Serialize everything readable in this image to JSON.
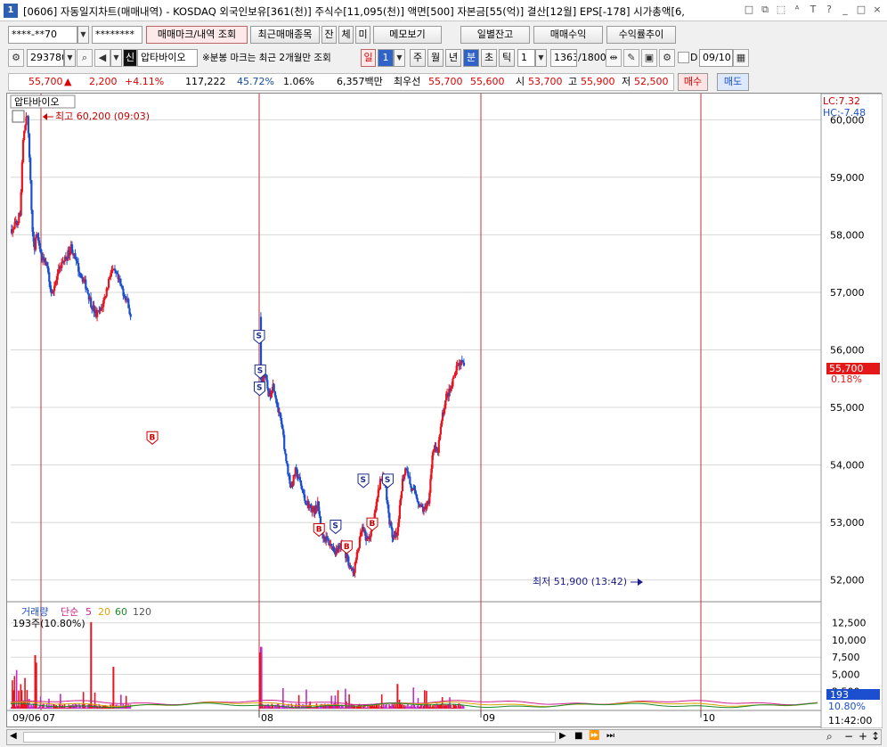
{
  "window": {
    "num": "1",
    "title": "[0606] 자동일지차트(매매내역) - KOSDAQ 외국인보유[361(천)] 주식수[11,095(천)] 액면[500] 자본금[55(억)] 결산[12월] EPS[-178] 시가총액[6,",
    "ctrl_icons": [
      "□",
      "⧉",
      "⬚",
      "ᴬ",
      "T",
      "?",
      "_",
      "□",
      "×"
    ]
  },
  "toolbar1": {
    "account": "****-**70",
    "password": "********",
    "mark_btn": "매매마크/내역 조회",
    "recent_btn": "최근매매종목",
    "jan_btn": "잔",
    "che_btn": "체",
    "mi_btn": "미",
    "memo_btn": "메모보기",
    "daily_btn": "일별잔고",
    "profit_btn": "매매수익",
    "return_btn": "수익률추이"
  },
  "toolbar2": {
    "code": "293780",
    "shin": "신",
    "name": "압타바이오",
    "note": "※분봉 마크는 최근 2개월만 조회",
    "period_label": "일",
    "period_value": "1",
    "weekly": "주",
    "monthly": "월",
    "yearly": "년",
    "minute": "분",
    "second": "초",
    "tick": "틱",
    "interval": "1",
    "count": "1363",
    "total": "/1800",
    "date": "09/10",
    "check_label": "D"
  },
  "infobar": {
    "price": "55,700",
    "arrow": "▲",
    "change": "2,200",
    "rate": "+4.11%",
    "volume": "117,222",
    "vol_ratio": "45.72%",
    "turnover": "1.06%",
    "amount": "6,357백만",
    "best_label": "최우선",
    "ask": "55,700",
    "bid": "55,600",
    "open_label": "시",
    "open": "53,700",
    "high_label": "고",
    "high": "55,900",
    "low_label": "저",
    "low": "52,500",
    "buy_btn": "매수",
    "sell_btn": "매도"
  },
  "chart": {
    "stock_tag": "압타바이오",
    "lc": "LC:7.32",
    "hc": "HC:-7.48",
    "high_note": "최고 60,200 (09:03)",
    "low_note": "최저 51,900 (13:42)",
    "price_tag": "55,700",
    "pct_tag": "0.18%",
    "vol_legend": {
      "label": "거래량",
      "ma_type": "단순",
      "ma5": "5",
      "ma20": "20",
      "ma60": "60",
      "ma120": "120"
    },
    "vol_info": "193주(10.80%)",
    "vol_tag": "193",
    "vol_pct_tag": "10.80%",
    "time_label": "11:42:00",
    "colors": {
      "up": "#e8141e",
      "down": "#1b4fd0",
      "vline": "#c33333",
      "grid": "#d8d8d8"
    }
  },
  "chart_data": {
    "type": "candlestick",
    "price_ticks": [
      52000,
      53000,
      54000,
      55000,
      56000,
      57000,
      58000,
      59000,
      60000
    ],
    "price_tick_labels": [
      "52,000",
      "53,000",
      "54,000",
      "55,000",
      "56,000",
      "57,000",
      "58,000",
      "59,000",
      "60,000"
    ],
    "price_range": [
      51700,
      60300
    ],
    "volume_ticks": [
      2500,
      5000,
      7500,
      10000,
      12500
    ],
    "volume_tick_labels": [
      "2,500",
      "5,000",
      "7,500",
      "10,000",
      "12,500"
    ],
    "volume_range": [
      0,
      13500
    ],
    "x_labels": [
      "09/06",
      "07",
      "08",
      "09",
      "10"
    ],
    "days": [
      "09/06",
      "09/07",
      "09/08",
      "09/09",
      "09/10"
    ],
    "close_path": [
      {
        "t": 0.0,
        "p": 58100
      },
      {
        "t": 0.02,
        "p": 58200
      },
      {
        "t": 0.035,
        "p": 58400
      },
      {
        "t": 0.045,
        "p": 59600
      },
      {
        "t": 0.055,
        "p": 59900
      },
      {
        "t": 0.063,
        "p": 60100
      },
      {
        "t": 0.07,
        "p": 59500
      },
      {
        "t": 0.08,
        "p": 58400
      },
      {
        "t": 0.09,
        "p": 57700
      },
      {
        "t": 0.1,
        "p": 58000
      },
      {
        "t": 0.12,
        "p": 57600
      },
      {
        "t": 0.14,
        "p": 57500
      },
      {
        "t": 0.16,
        "p": 57000
      },
      {
        "t": 0.18,
        "p": 57200
      },
      {
        "t": 0.2,
        "p": 57500
      },
      {
        "t": 0.22,
        "p": 57600
      },
      {
        "t": 0.24,
        "p": 57800
      },
      {
        "t": 0.26,
        "p": 57500
      },
      {
        "t": 0.28,
        "p": 57300
      },
      {
        "t": 0.3,
        "p": 57100
      },
      {
        "t": 0.32,
        "p": 56800
      },
      {
        "t": 0.34,
        "p": 56600
      },
      {
        "t": 0.36,
        "p": 56700
      },
      {
        "t": 0.38,
        "p": 57000
      },
      {
        "t": 0.4,
        "p": 57400
      },
      {
        "t": 0.42,
        "p": 57300
      },
      {
        "t": 0.44,
        "p": 57100
      },
      {
        "t": 0.46,
        "p": 56900
      },
      {
        "t": 0.47,
        "p": 56800
      },
      {
        "t": 0.5,
        "p": 55900
      },
      {
        "t": 0.52,
        "p": 55300
      },
      {
        "t": 0.54,
        "p": 55500
      },
      {
        "t": 0.56,
        "p": 55000
      },
      {
        "t": 0.58,
        "p": 54600
      },
      {
        "t": 0.6,
        "p": 54800
      },
      {
        "t": 0.62,
        "p": 54300
      },
      {
        "t": 0.64,
        "p": 54700
      },
      {
        "t": 0.66,
        "p": 55000
      },
      {
        "t": 0.68,
        "p": 55200
      },
      {
        "t": 0.7,
        "p": 54900
      },
      {
        "t": 0.72,
        "p": 54700
      },
      {
        "t": 0.74,
        "p": 54900
      },
      {
        "t": 0.76,
        "p": 55000
      },
      {
        "t": 0.78,
        "p": 54900
      },
      {
        "t": 0.8,
        "p": 54800
      },
      {
        "t": 0.82,
        "p": 54900
      },
      {
        "t": 0.84,
        "p": 54800
      },
      {
        "t": 0.86,
        "p": 54700
      },
      {
        "t": 0.88,
        "p": 54800
      },
      {
        "t": 0.9,
        "p": 54700
      },
      {
        "t": 0.93,
        "p": 54800
      },
      {
        "t": 1.0,
        "p": 55400
      },
      {
        "t": 1.02,
        "p": 55600
      },
      {
        "t": 1.04,
        "p": 55200
      },
      {
        "t": 1.06,
        "p": 55400
      },
      {
        "t": 1.08,
        "p": 55000
      },
      {
        "t": 1.1,
        "p": 54600
      },
      {
        "t": 1.12,
        "p": 54000
      },
      {
        "t": 1.14,
        "p": 53600
      },
      {
        "t": 1.16,
        "p": 53900
      },
      {
        "t": 1.18,
        "p": 53700
      },
      {
        "t": 1.2,
        "p": 53400
      },
      {
        "t": 1.22,
        "p": 53300
      },
      {
        "t": 1.24,
        "p": 53200
      },
      {
        "t": 1.26,
        "p": 53300
      },
      {
        "t": 1.28,
        "p": 52800
      },
      {
        "t": 1.3,
        "p": 52700
      },
      {
        "t": 1.32,
        "p": 52600
      },
      {
        "t": 1.34,
        "p": 52500
      },
      {
        "t": 1.36,
        "p": 52600
      },
      {
        "t": 1.38,
        "p": 52500
      },
      {
        "t": 1.4,
        "p": 52300
      },
      {
        "t": 1.42,
        "p": 52100
      },
      {
        "t": 1.44,
        "p": 52500
      },
      {
        "t": 1.46,
        "p": 52900
      },
      {
        "t": 1.48,
        "p": 52700
      },
      {
        "t": 1.5,
        "p": 52800
      },
      {
        "t": 1.52,
        "p": 53200
      },
      {
        "t": 1.54,
        "p": 53700
      },
      {
        "t": 1.56,
        "p": 53800
      },
      {
        "t": 1.58,
        "p": 53100
      },
      {
        "t": 1.6,
        "p": 52700
      },
      {
        "t": 1.62,
        "p": 52800
      },
      {
        "t": 1.64,
        "p": 53700
      },
      {
        "t": 1.66,
        "p": 54000
      },
      {
        "t": 1.68,
        "p": 53600
      },
      {
        "t": 1.7,
        "p": 53500
      },
      {
        "t": 1.72,
        "p": 53300
      },
      {
        "t": 1.74,
        "p": 53200
      },
      {
        "t": 1.76,
        "p": 53400
      },
      {
        "t": 1.78,
        "p": 54300
      },
      {
        "t": 1.8,
        "p": 54200
      },
      {
        "t": 1.82,
        "p": 54800
      },
      {
        "t": 1.84,
        "p": 55200
      },
      {
        "t": 1.86,
        "p": 55300
      },
      {
        "t": 1.88,
        "p": 55600
      },
      {
        "t": 1.9,
        "p": 55800
      },
      {
        "t": 1.92,
        "p": 55700
      }
    ],
    "day_opens": [
      {
        "t": 0.485,
        "p": 56200
      },
      {
        "t": 0.98,
        "p": 54600
      },
      {
        "t": 1.5,
        "p": 52700
      }
    ],
    "markers": [
      {
        "type": "B",
        "t": 0.57,
        "p": 54500
      },
      {
        "type": "S",
        "t": 1.0,
        "p": 56200
      },
      {
        "type": "S",
        "t": 1.005,
        "p": 55600
      },
      {
        "type": "S",
        "t": 1.002,
        "p": 55300
      },
      {
        "type": "B",
        "t": 1.27,
        "p": 52900
      },
      {
        "type": "S",
        "t": 1.345,
        "p": 52900
      },
      {
        "type": "B",
        "t": 1.395,
        "p": 52600
      },
      {
        "type": "S",
        "t": 1.47,
        "p": 53700
      },
      {
        "type": "B",
        "t": 1.51,
        "p": 53000
      },
      {
        "type": "S",
        "t": 1.58,
        "p": 53700
      }
    ]
  }
}
